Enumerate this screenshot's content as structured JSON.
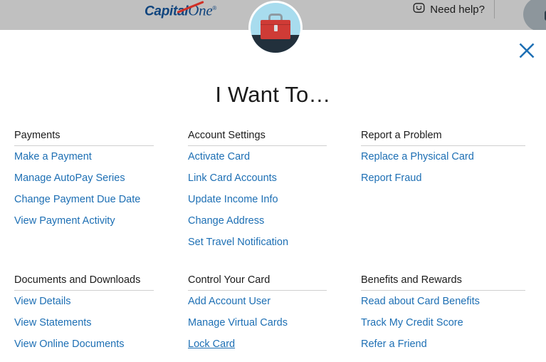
{
  "header": {
    "brand": {
      "capital": "Capital",
      "one": "One",
      "registered": "®"
    },
    "need_help_label": "Need help?",
    "need_help_icon": "chat-smiley-icon",
    "avatar_icon": "user-avatar"
  },
  "modal": {
    "title": "I Want To…",
    "close_icon": "close-icon",
    "badge_icon": "briefcase-icon",
    "sections": [
      {
        "heading": "Payments",
        "links": [
          {
            "label": "Make a Payment",
            "active": false
          },
          {
            "label": "Manage AutoPay Series",
            "active": false
          },
          {
            "label": "Change Payment Due Date",
            "active": false
          },
          {
            "label": "View Payment Activity",
            "active": false
          }
        ]
      },
      {
        "heading": "Account Settings",
        "links": [
          {
            "label": "Activate Card",
            "active": false
          },
          {
            "label": "Link Card Accounts",
            "active": false
          },
          {
            "label": "Update Income Info",
            "active": false
          },
          {
            "label": "Change Address",
            "active": false
          },
          {
            "label": "Set Travel Notification",
            "active": false
          }
        ]
      },
      {
        "heading": "Report a Problem",
        "links": [
          {
            "label": "Replace a Physical Card",
            "active": false
          },
          {
            "label": "Report Fraud",
            "active": false
          }
        ]
      },
      {
        "heading": "Documents and Downloads",
        "links": [
          {
            "label": "View Details",
            "active": false
          },
          {
            "label": "View Statements",
            "active": false
          },
          {
            "label": "View Online Documents",
            "active": false
          }
        ]
      },
      {
        "heading": "Control Your Card",
        "links": [
          {
            "label": "Add Account User",
            "active": false
          },
          {
            "label": "Manage Virtual Cards",
            "active": false
          },
          {
            "label": "Lock Card",
            "active": true
          }
        ]
      },
      {
        "heading": "Benefits and Rewards",
        "links": [
          {
            "label": "Read about Card Benefits",
            "active": false
          },
          {
            "label": "Track My Credit Score",
            "active": false
          },
          {
            "label": "Refer a Friend",
            "active": false
          }
        ]
      }
    ]
  },
  "colors": {
    "link_blue": "#1d6fb4",
    "header_gray": "#c0c0c0",
    "brand_navy": "#11457e",
    "brand_red": "#d03027",
    "badge_blue": "#a8dcee",
    "badge_navy": "#22303c",
    "briefcase_red": "#cf3b36"
  }
}
